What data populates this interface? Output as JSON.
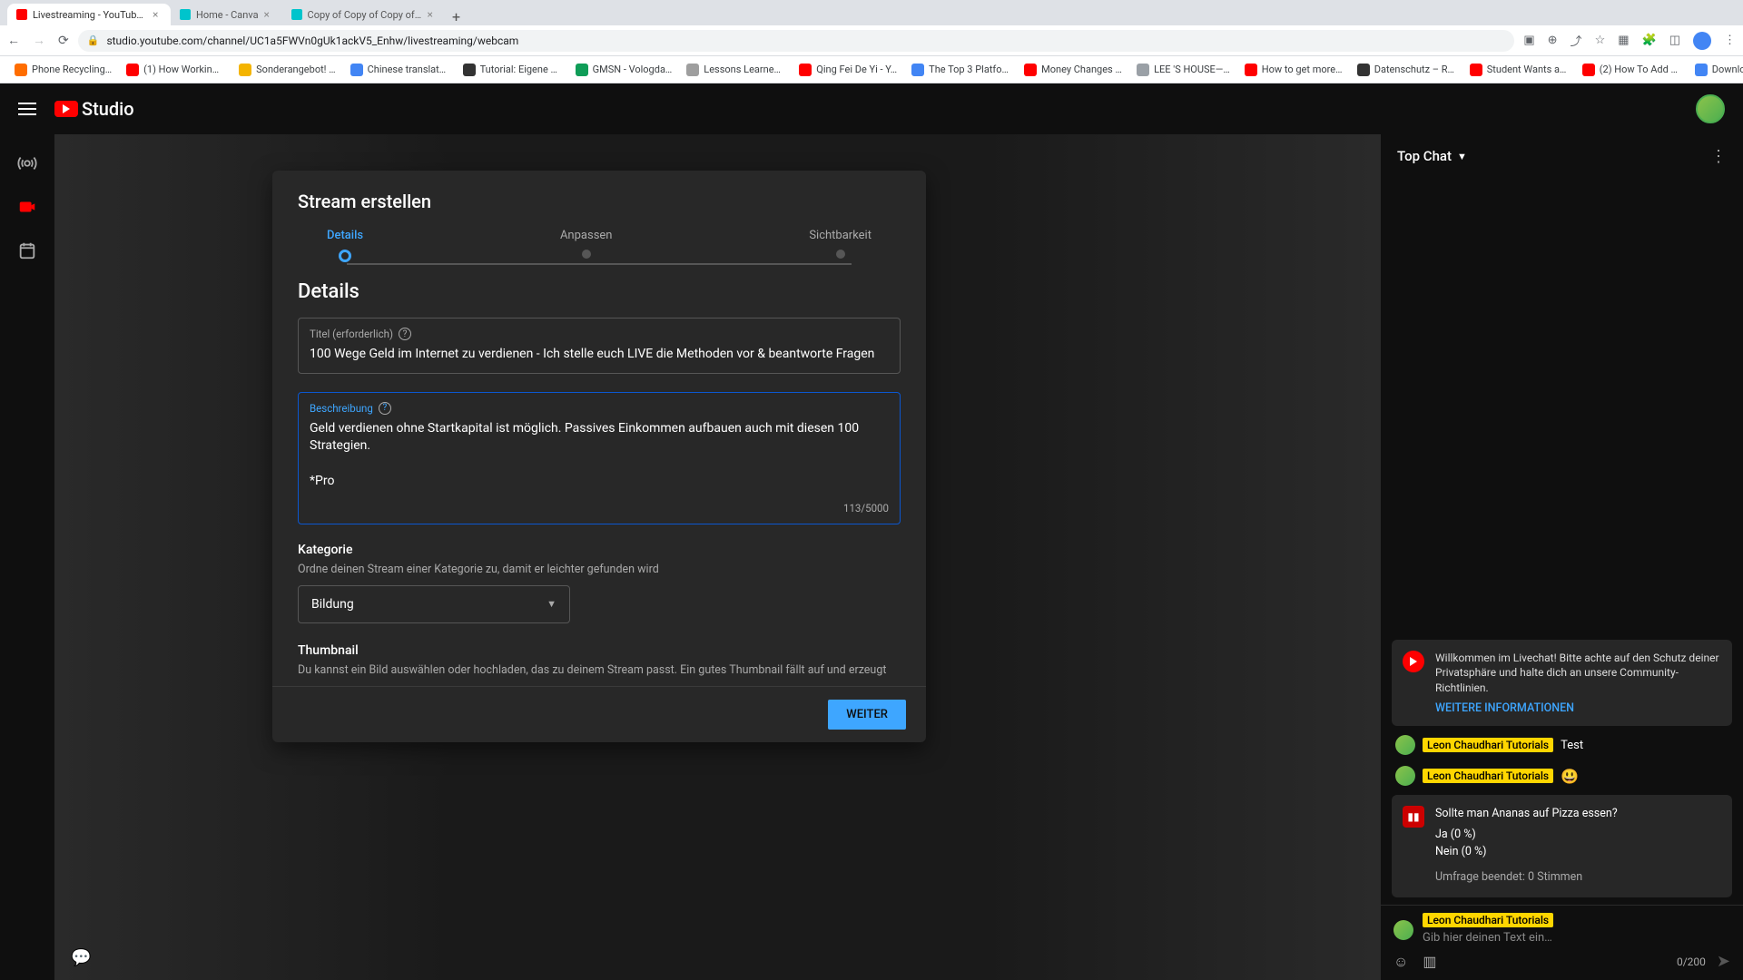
{
  "browser": {
    "tabs": [
      {
        "title": "Livestreaming - YouTube S",
        "favicon": "#ff0000",
        "active": true
      },
      {
        "title": "Home - Canva",
        "favicon": "#00c4cc",
        "active": false
      },
      {
        "title": "Copy of Copy of Copy of Copy",
        "favicon": "#00c4cc",
        "active": false
      }
    ],
    "url": "studio.youtube.com/channel/UC1a5FWVn0gUk1ackV5_Enhw/livestreaming/webcam",
    "bookmarks": [
      {
        "label": "Phone Recycling…",
        "color": "#ff6d00"
      },
      {
        "label": "(1) How Working a…",
        "color": "#ff0000"
      },
      {
        "label": "Sonderangebot! …",
        "color": "#f4b400"
      },
      {
        "label": "Chinese translati…",
        "color": "#4285f4"
      },
      {
        "label": "Tutorial: Eigene F…",
        "color": "#333"
      },
      {
        "label": "GMSN - Vologda…",
        "color": "#0f9d58"
      },
      {
        "label": "Lessons Learned f…",
        "color": "#9e9e9e"
      },
      {
        "label": "Qing Fei De Yi - Y…",
        "color": "#ff0000"
      },
      {
        "label": "The Top 3 Platfor…",
        "color": "#4285f4"
      },
      {
        "label": "Money Changes E…",
        "color": "#ff0000"
      },
      {
        "label": "LEE 'S HOUSE—…",
        "color": "#9aa0a6"
      },
      {
        "label": "How to get more v…",
        "color": "#ff0000"
      },
      {
        "label": "Datenschutz – Re…",
        "color": "#333"
      },
      {
        "label": "Student Wants an…",
        "color": "#ff0000"
      },
      {
        "label": "(2) How To Add A…",
        "color": "#ff0000"
      },
      {
        "label": "Download - Cooki…",
        "color": "#4285f4"
      }
    ]
  },
  "header": {
    "logo": "Studio"
  },
  "dialog": {
    "title": "Stream erstellen",
    "steps": [
      "Details",
      "Anpassen",
      "Sichtbarkeit"
    ],
    "section": "Details",
    "title_field": {
      "label": "Titel (erforderlich)",
      "value": "100 Wege Geld im Internet zu verdienen - Ich stelle euch LIVE die Methoden vor & beantworte Fragen"
    },
    "desc_field": {
      "label": "Beschreibung",
      "value": "Geld verdienen ohne Startkapital ist möglich. Passives Einkommen aufbauen auch mit diesen 100 Strategien.\n\n*Pro",
      "counter": "113/5000"
    },
    "category": {
      "title": "Kategorie",
      "hint": "Ordne deinen Stream einer Kategorie zu, damit er leichter gefunden wird",
      "value": "Bildung"
    },
    "thumbnail": {
      "title": "Thumbnail",
      "hint": "Du kannst ein Bild auswählen oder hochladen, das zu deinem Stream passt. Ein gutes Thumbnail fällt auf und erzeugt"
    },
    "next": "WEITER"
  },
  "chat": {
    "title": "Top Chat",
    "welcome": {
      "text": "Willkommen im Livechat! Bitte achte auf den Schutz deiner Privatsphäre und halte dich an unsere Community-Richtlinien.",
      "link": "WEITERE INFORMATIONEN"
    },
    "messages": [
      {
        "author": "Leon Chaudhari Tutorials",
        "text": "Test",
        "emoji": ""
      },
      {
        "author": "Leon Chaudhari Tutorials",
        "text": "",
        "emoji": "😃"
      }
    ],
    "poll": {
      "question": "Sollte man Ananas auf Pizza essen?",
      "opt1": "Ja (0 %)",
      "opt2": "Nein (0 %)",
      "result": "Umfrage beendet: 0 Stimmen"
    },
    "input": {
      "author": "Leon Chaudhari Tutorials",
      "placeholder": "Gib hier deinen Text ein…",
      "counter": "0/200"
    }
  }
}
